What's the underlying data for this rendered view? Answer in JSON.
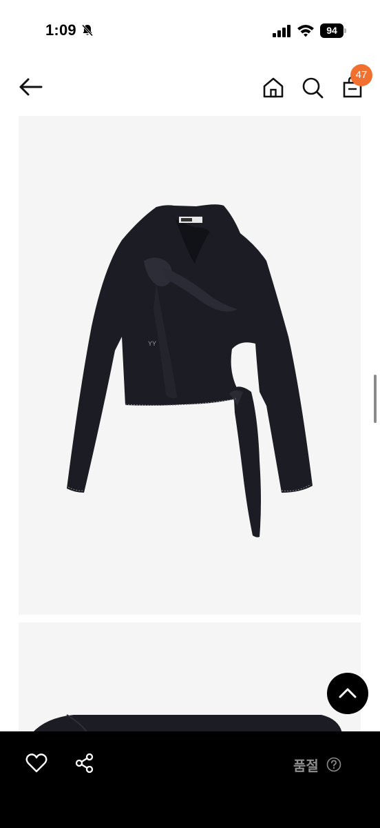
{
  "status_bar": {
    "time": "1:09",
    "battery": "94",
    "icons": [
      "bell-slash-icon",
      "signal-icon",
      "wifi-icon",
      "battery-icon"
    ]
  },
  "header": {
    "back_icon": "arrow-left-icon",
    "home_icon": "home-icon",
    "search_icon": "search-icon",
    "bag_icon": "shopping-bag-icon",
    "cart_count": "47"
  },
  "product": {
    "images": [
      "black-long-sleeve-tie-top",
      "black-top-detail"
    ],
    "logo_embroidery": "YY"
  },
  "colors": {
    "accent_badge": "#f2702f",
    "bottom_bar": "#000000",
    "image_background": "#f5f5f5",
    "sold_out_text": "#8e8e8e"
  },
  "bottom_bar": {
    "like_icon": "heart-icon",
    "share_icon": "share-icon",
    "status_label": "품절",
    "help_icon": "question-circle-icon"
  },
  "scroll_top_icon": "chevron-up-icon"
}
